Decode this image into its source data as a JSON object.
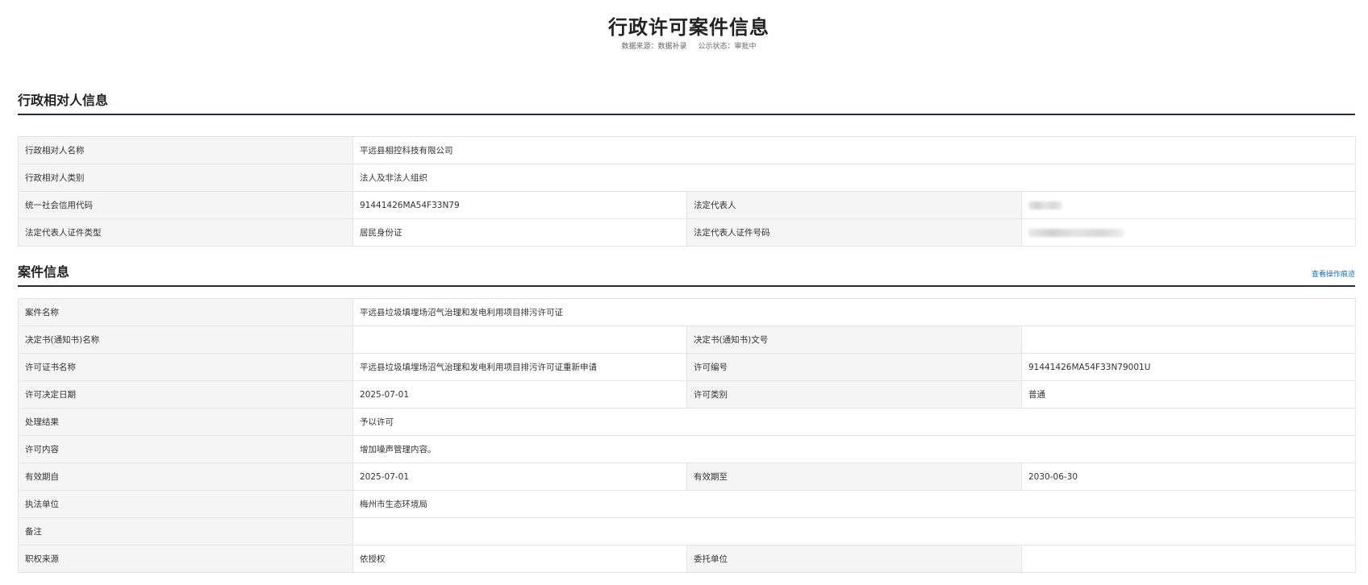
{
  "page": {
    "title": "行政许可案件信息",
    "data_source": "数据来源：数据补录",
    "public_status": "公示状态：审批中"
  },
  "party_section": {
    "title": "行政相对人信息",
    "rows": [
      {
        "label": "行政相对人名称",
        "value": "平远县相控科技有限公司"
      },
      {
        "label": "行政相对人类别",
        "value": "法人及非法人组织"
      },
      {
        "label": "统一社会信用代码",
        "value": "91441426MA54F33N79",
        "label2": "法定代表人",
        "value2": ""
      },
      {
        "label": "法定代表人证件类型",
        "value": "居民身份证",
        "label2": "法定代表人证件号码",
        "value2": ""
      }
    ]
  },
  "case_section": {
    "title": "案件信息",
    "link_label": "查看操作痕迹",
    "rows": [
      {
        "label": "案件名称",
        "value": "平远县垃圾填埋场沼气治理和发电利用项目排污许可证"
      },
      {
        "label": "决定书(通知书)名称",
        "value": "",
        "label2": "决定书(通知书)文号",
        "value2": ""
      },
      {
        "label": "许可证书名称",
        "value": "平远县垃圾填埋场沼气治理和发电利用项目排污许可证重新申请",
        "label2": "许可编号",
        "value2": "91441426MA54F33N79001U"
      },
      {
        "label": "许可决定日期",
        "value": "2025-07-01",
        "label2": "许可类别",
        "value2": "普通"
      },
      {
        "label": "处理结果",
        "value": "予以许可"
      },
      {
        "label": "许可内容",
        "value": "增加噪声管理内容。"
      },
      {
        "label": "有效期自",
        "value": "2025-07-01",
        "label2": "有效期至",
        "value2": "2030-06-30"
      },
      {
        "label": "执法单位",
        "value": "梅州市生态环境局"
      },
      {
        "label": "备注",
        "value": ""
      },
      {
        "label": "职权来源",
        "value": "依授权",
        "label2": "委托单位",
        "value2": ""
      }
    ]
  }
}
